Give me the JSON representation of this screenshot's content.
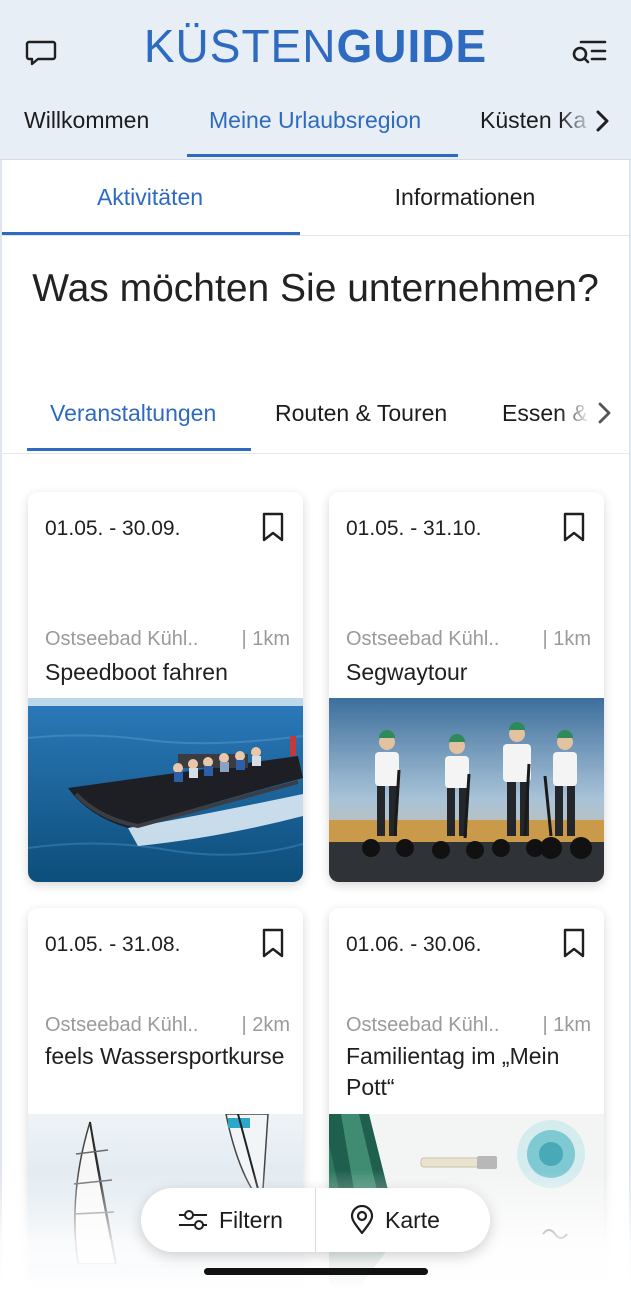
{
  "header": {
    "logo_light": "KÜSTEN",
    "logo_bold": "GUIDE",
    "chat_icon": "chat-bubble-icon",
    "menu_icon": "search-menu-icon"
  },
  "main_nav": {
    "items": [
      "Willkommen",
      "Meine Urlaubsregion",
      "Küsten Ka"
    ],
    "active": "Meine Urlaubsregion"
  },
  "tabs": {
    "items": [
      "Aktivitäten",
      "Informationen"
    ],
    "active": "Aktivitäten"
  },
  "heading": "Was möchten Sie unternehmen?",
  "categories": {
    "items": [
      "Veranstaltungen",
      "Routen & Touren",
      "Essen &"
    ],
    "active": "Veranstaltungen"
  },
  "cards": [
    {
      "date": "01.05. - 30.09.",
      "location": "Ostseebad Kühl..",
      "distance": "| 1km",
      "title": "Speedboot fahren",
      "image": "speedboat"
    },
    {
      "date": "01.05. - 31.10.",
      "location": "Ostseebad Kühl..",
      "distance": "| 1km",
      "title": "Segwaytour",
      "image": "segway"
    },
    {
      "date": "01.05. - 31.08.",
      "location": "Ostseebad Kühl..",
      "distance": "| 2km",
      "title": "feels Wassersportkurse",
      "image": "windsurf"
    },
    {
      "date": "01.06. - 30.06.",
      "location": "Ostseebad Kühl..",
      "distance": "| 1km",
      "title": "Familientag im „Mein Pott“",
      "image": "pottery"
    }
  ],
  "actions": {
    "filter_label": "Filtern",
    "map_label": "Karte"
  },
  "colors": {
    "accent": "#2e6bc0",
    "header_bg": "#e8eef6"
  }
}
